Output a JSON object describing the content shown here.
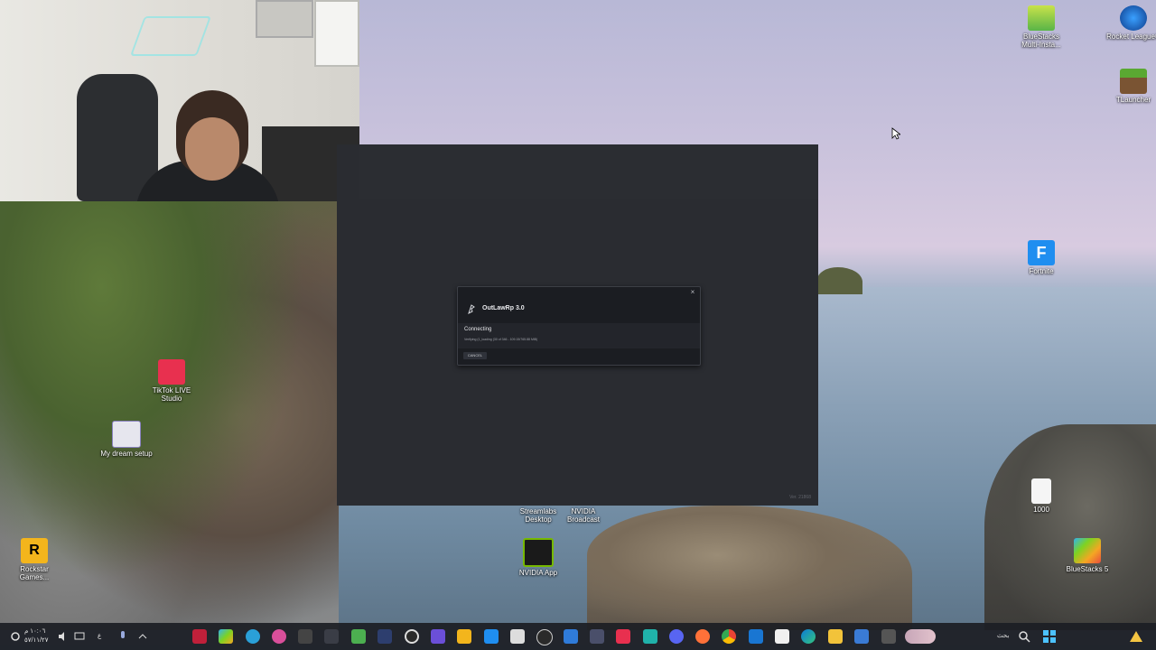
{
  "launcher": {
    "version": "Ver. 21868"
  },
  "dialog": {
    "title": "OutLawRp 3.0",
    "status": "Connecting",
    "detail": "Verifying (1_loading (30 of 346 - 109.15/765.88 MiB)",
    "cancel_label": "CANCEL",
    "close_glyph": "×"
  },
  "desktop_icons": {
    "bluestacks_multi": "BlueStacks Multi-Insta...",
    "rocket_league": "Rocket League®",
    "tlauncher": "TLauncher",
    "fortnite": "Fortnite",
    "tiktok_live": "TikTok LIVE Studio",
    "my_dream_setup": "My dream setup",
    "rockstar": "Rockstar Games...",
    "streamlabs": "Streamlabs Desktop",
    "nvidia_broadcast": "NVIDIA Broadcast",
    "nvidia_app": "NVIDIA App",
    "file_1000": "1000",
    "bluestacks5": "BlueStacks 5"
  },
  "taskbar": {
    "clock_time": "١٠:٠٦ م",
    "clock_date": "٥٧/١١/٢٧",
    "lang": "ع",
    "search_label": "بحث"
  }
}
